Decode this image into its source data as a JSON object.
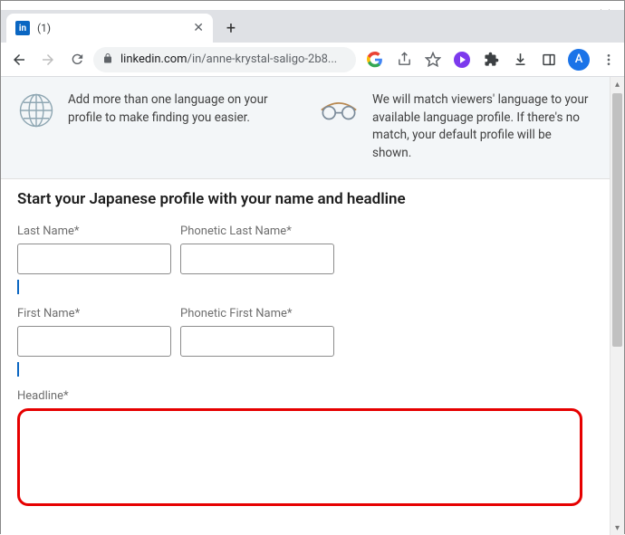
{
  "window": {
    "tab_title": "(1)",
    "url_display": "linkedin.com/in/anne-krystal-saligo-2b8...",
    "url_host": "linkedin.com",
    "url_path": "/in/anne-krystal-saligo-2b8...",
    "avatar_initial": "A"
  },
  "banner": {
    "left_text": "Add more than one language on your profile to make finding you easier.",
    "right_text": "We will match viewers' language to your available language profile. If there's no match, your default profile will be shown."
  },
  "form": {
    "heading": "Start your Japanese profile with your name and headline",
    "last_name_label": "Last Name*",
    "phonetic_last_name_label": "Phonetic Last Name*",
    "first_name_label": "First Name*",
    "phonetic_first_name_label": "Phonetic First Name*",
    "headline_label": "Headline*",
    "last_name_value": "",
    "phonetic_last_name_value": "",
    "first_name_value": "",
    "phonetic_first_name_value": "",
    "headline_value": ""
  }
}
